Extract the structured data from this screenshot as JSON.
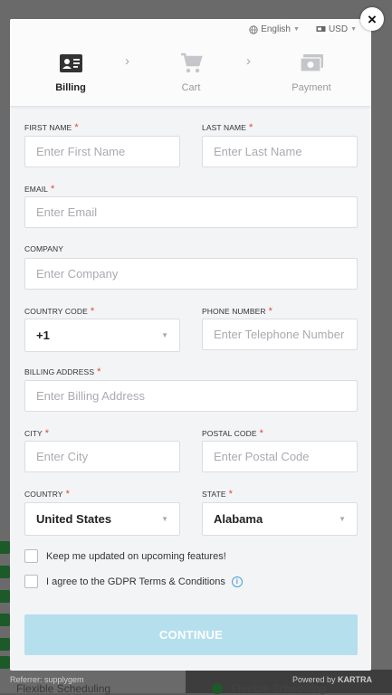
{
  "topbar": {
    "language": "English",
    "currency": "USD"
  },
  "steps": [
    {
      "label": "Billing",
      "icon": "id-card-icon"
    },
    {
      "label": "Cart",
      "icon": "cart-icon"
    },
    {
      "label": "Payment",
      "icon": "payment-icon"
    }
  ],
  "form": {
    "first_name": {
      "label": "FIRST NAME",
      "placeholder": "Enter First Name",
      "required": "*"
    },
    "last_name": {
      "label": "LAST NAME",
      "placeholder": "Enter Last Name",
      "required": "*"
    },
    "email": {
      "label": "EMAIL",
      "placeholder": "Enter Email",
      "required": "*"
    },
    "company": {
      "label": "COMPANY",
      "placeholder": "Enter Company"
    },
    "country_code": {
      "label": "COUNTRY CODE",
      "value": "+1",
      "required": "*"
    },
    "phone": {
      "label": "PHONE NUMBER",
      "placeholder": "Enter Telephone Number",
      "required": "*"
    },
    "billing_address": {
      "label": "BILLING ADDRESS",
      "placeholder": "Enter Billing Address",
      "required": "*"
    },
    "city": {
      "label": "CITY",
      "placeholder": "Enter City",
      "required": "*"
    },
    "postal_code": {
      "label": "POSTAL CODE",
      "placeholder": "Enter Postal Code",
      "required": "*"
    },
    "country": {
      "label": "COUNTRY",
      "value": "United States",
      "required": "*"
    },
    "state": {
      "label": "STATE",
      "value": "Alabama",
      "required": "*"
    }
  },
  "checkboxes": {
    "updates": "Keep me updated on upcoming features!",
    "gdpr": "I agree to the GDPR Terms & Conditions"
  },
  "continue_label": "CONTINUE",
  "footer": {
    "referrer": "Referrer: supplygem",
    "powered": "Powered by",
    "brand": "KARTRA"
  },
  "background": {
    "left_text": "Flexible Scheduling",
    "right_text": "Flexible Scheduling"
  },
  "colors": {
    "accent": "#b6dfee",
    "required": "#e0473b",
    "info": "#4a9fd8"
  }
}
